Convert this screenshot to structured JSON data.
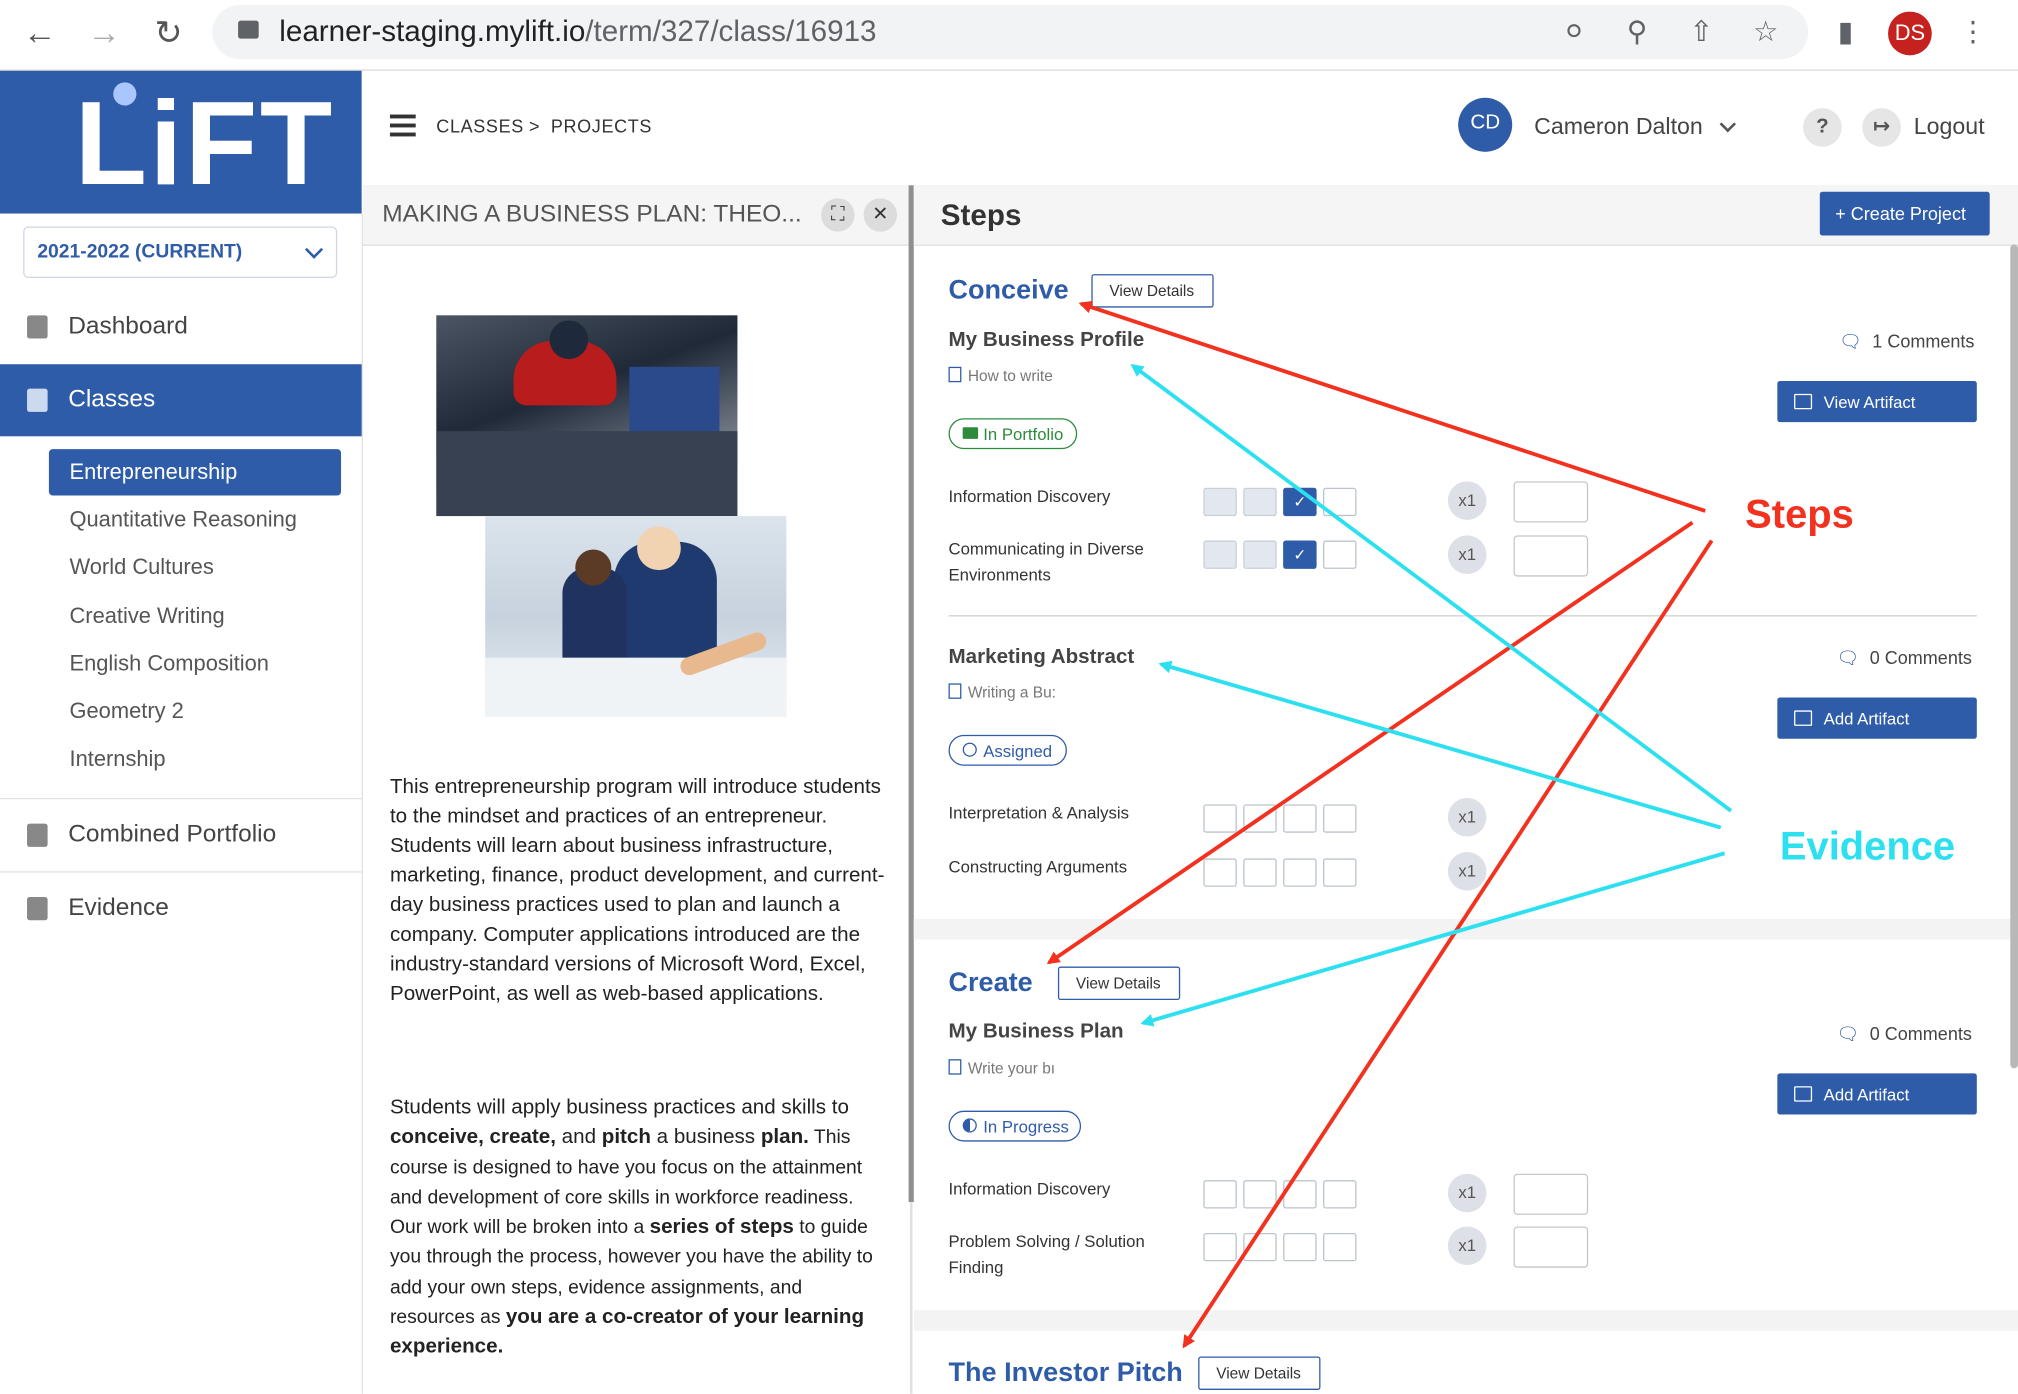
{
  "browser": {
    "url_host": "learner-staging.mylift.io",
    "url_path": "/term/327/class/16913",
    "profile": "DS"
  },
  "sidebar": {
    "logo": "LiFT",
    "term": "2021-2022 (CURRENT)",
    "items": [
      {
        "label": "Dashboard"
      },
      {
        "label": "Classes"
      },
      {
        "label": "Combined Portfolio"
      },
      {
        "label": "Evidence"
      }
    ],
    "classes": [
      "Entrepreneurship",
      "Quantitative Reasoning",
      "World Cultures",
      "Creative Writing",
      "English Composition",
      "Geometry 2",
      "Internship"
    ]
  },
  "header": {
    "crumb1": "CLASSES",
    "crumb_sep": ">",
    "crumb2": "PROJECTS",
    "user_initials": "CD",
    "user_name": "Cameron Dalton",
    "help": "?",
    "logout": "Logout"
  },
  "left_panel": {
    "title": "MAKING A BUSINESS PLAN: THEO...",
    "para1": "This entrepreneurship program will introduce students to the mindset and practices of an entrepreneur. Students will learn about business infrastructure, marketing, finance, product development, and current-day business practices used to plan and launch a company. Computer applications introduced are the industry-standard versions of Microsoft Word, Excel, PowerPoint, as well as web-based applications.",
    "p2": {
      "a": "Students will apply business practices and skills to ",
      "b": "conceive, create,",
      "c": " and ",
      "d": "pitch",
      "e": " a business ",
      "f": "plan.",
      "g": " This course is designed to have you focus on the attainment and development of core skills in workforce readiness. Our work will be broken into a ",
      "h": "series of steps",
      "i": " to guide you through the process, however you have the ability to add your own steps, evidence assignments, and resources as ",
      "j": "you are a co-creator of your learning experience."
    }
  },
  "right_panel": {
    "title": "Steps",
    "create_btn": "+ Create Project",
    "view_details": "View Details",
    "steps": [
      {
        "title": "Conceive",
        "evidence": [
          {
            "title": "My Business Profile",
            "sub": "How to write",
            "comments": "1 Comments",
            "button": "View Artifact",
            "status": "In Portfolio",
            "skills": [
              {
                "name": "Information Discovery",
                "level": 3,
                "weight": "x1"
              },
              {
                "name": "Communicating in Diverse Environments",
                "level": 3,
                "weight": "x1"
              }
            ]
          },
          {
            "title": "Marketing Abstract",
            "sub": "Writing a Bu:",
            "comments": "0 Comments",
            "button": "Add Artifact",
            "status": "Assigned",
            "skills": [
              {
                "name": "Interpretation & Analysis",
                "level": 0,
                "weight": "x1"
              },
              {
                "name": "Constructing Arguments",
                "level": 0,
                "weight": "x1"
              }
            ]
          }
        ]
      },
      {
        "title": "Create",
        "evidence": [
          {
            "title": "My Business Plan",
            "sub": "Write your bı",
            "comments": "0 Comments",
            "button": "Add Artifact",
            "status": "In Progress",
            "skills": [
              {
                "name": "Information Discovery",
                "level": 0,
                "weight": "x1"
              },
              {
                "name": "Problem Solving / Solution Finding",
                "level": 0,
                "weight": "x1"
              }
            ]
          }
        ]
      },
      {
        "title": "The Investor Pitch"
      }
    ]
  },
  "annotations": {
    "steps": "Steps",
    "evidence": "Evidence",
    "steps_color": "#f2311f",
    "evidence_color": "#2de0f0"
  },
  "colors": {
    "brand": "#2f5ca8",
    "portfolio_green": "#2e8b3c"
  }
}
